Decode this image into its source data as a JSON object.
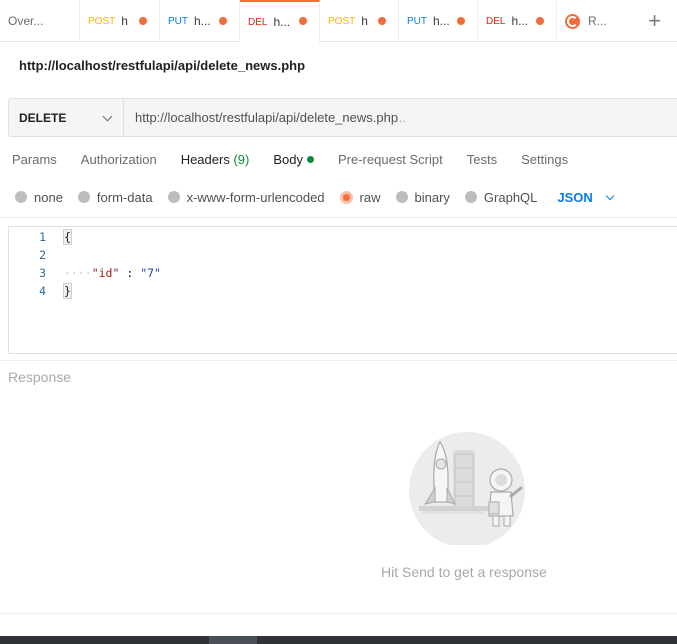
{
  "tabs": [
    {
      "method": "",
      "name": "Over...",
      "dot": false,
      "type": "overview"
    },
    {
      "method": "POST",
      "name": "h",
      "dot": true,
      "type": "post"
    },
    {
      "method": "PUT",
      "name": "h...",
      "dot": true,
      "type": "put"
    },
    {
      "method": "DEL",
      "name": "h...",
      "dot": true,
      "type": "del",
      "active": true
    },
    {
      "method": "POST",
      "name": "h",
      "dot": true,
      "type": "post"
    },
    {
      "method": "PUT",
      "name": "h...",
      "dot": true,
      "type": "put"
    },
    {
      "method": "DEL",
      "name": "h...",
      "dot": true,
      "type": "del"
    },
    {
      "method": "",
      "name": "R...",
      "dot": false,
      "type": "runner"
    }
  ],
  "new_tab_label": "+",
  "request": {
    "title": "http://localhost/restfulapi/api/delete_news.php",
    "method": "DELETE",
    "url": "http://localhost/restfulapi/api/delete_news.php",
    "url_suffix": "..."
  },
  "subtabs": {
    "params": "Params",
    "authorization": "Authorization",
    "headers": "Headers",
    "headers_count": "(9)",
    "body": "Body",
    "prerequest": "Pre-request Script",
    "tests": "Tests",
    "settings": "Settings"
  },
  "body_types": {
    "none": "none",
    "form_data": "form-data",
    "urlencoded": "x-www-form-urlencoded",
    "raw": "raw",
    "binary": "binary",
    "graphql": "GraphQL",
    "language": "JSON"
  },
  "editor": {
    "line_numbers": [
      "1",
      "2",
      "3",
      "4"
    ],
    "open_brace": "{",
    "indent": "····",
    "key": "\"id\"",
    "colon": " : ",
    "value": "\"7\"",
    "close_brace": "}"
  },
  "response": {
    "title": "Response",
    "hint": "Hit Send to get a response"
  },
  "colors": {
    "accent": "#ff6c37",
    "post": "#ffb400",
    "put": "#097bed",
    "delete": "#eb2013",
    "success": "#0c8a3c"
  }
}
